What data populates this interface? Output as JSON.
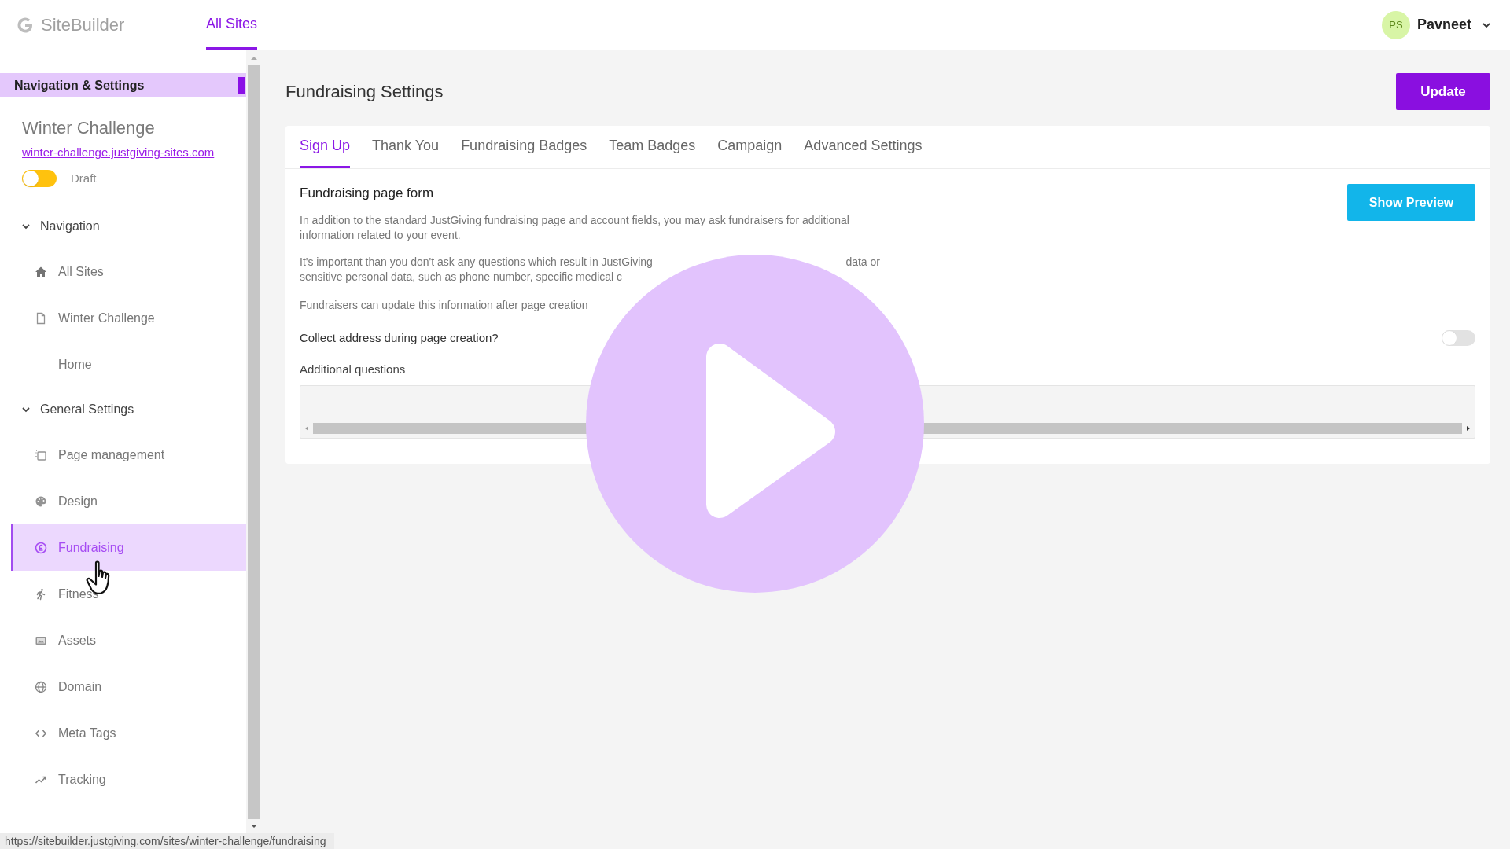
{
  "header": {
    "logo": "SiteBuilder",
    "nav": [
      {
        "label": "All Sites",
        "selected": true
      }
    ],
    "user": {
      "initials": "PS",
      "name": "Pavneet"
    }
  },
  "sidebar": {
    "title": "Navigation & Settings",
    "site": {
      "name": "Winter Challenge",
      "url": "winter-challenge.justgiving-sites.com",
      "status": "Draft",
      "on": false
    },
    "sections": [
      {
        "label": "Navigation",
        "expanded": true,
        "children": [
          {
            "label": "All Sites",
            "selected": false
          },
          {
            "label": "Winter Challenge",
            "selected": false
          },
          {
            "label": "Home",
            "selected": false
          }
        ]
      },
      {
        "label": "General Settings",
        "expanded": true,
        "children": [
          {
            "label": "Page management",
            "selected": false
          },
          {
            "label": "Design",
            "selected": false
          },
          {
            "label": "Fundraising",
            "selected": true
          },
          {
            "label": "Fitness",
            "selected": false
          },
          {
            "label": "Assets",
            "selected": false
          },
          {
            "label": "Domain",
            "selected": false
          },
          {
            "label": "Meta Tags",
            "selected": false
          },
          {
            "label": "Tracking",
            "selected": false
          }
        ]
      }
    ]
  },
  "main": {
    "title": "Fundraising Settings",
    "update_button": "Update",
    "tabs": [
      {
        "label": "Sign Up",
        "selected": true
      },
      {
        "label": "Thank You",
        "selected": false
      },
      {
        "label": "Fundraising Badges",
        "selected": false
      },
      {
        "label": "Team Badges",
        "selected": false
      },
      {
        "label": "Campaign",
        "selected": false
      },
      {
        "label": "Advanced Settings",
        "selected": false
      }
    ],
    "form": {
      "heading": "Fundraising page form",
      "preview_button": "Show Preview",
      "intro": "In addition to the standard JustGiving fundraising page and account fields, you may ask fundraisers for additional information related to your event.",
      "notice_fragments": [
        "It's important than you don't ask any questions which result in JustGiving",
        "data or",
        "sensitive personal data, such as phone number, specific medical c"
      ],
      "update_note": "Fundraisers can update this information after page creation",
      "collect_address": {
        "label": "Collect address during page creation?",
        "on": false
      },
      "additional_questions": {
        "label": "Additional questions"
      }
    }
  },
  "video_overlay": {
    "play_button": true
  },
  "status_bar": {
    "url": "https://sitebuilder.justgiving.com/sites/winter-challenge/fundraising"
  }
}
